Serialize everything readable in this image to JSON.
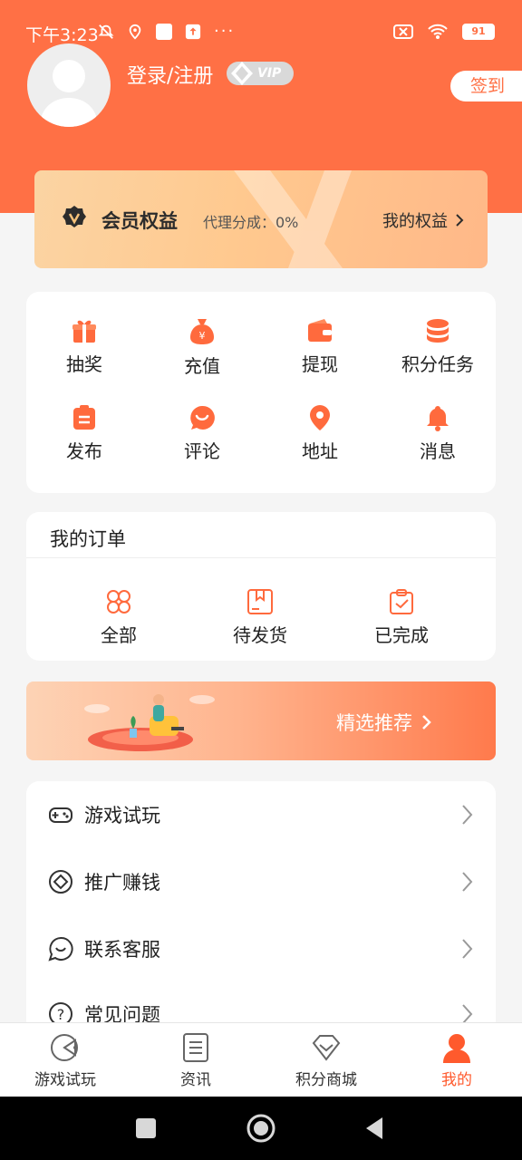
{
  "status_bar": {
    "time": "下午3:23",
    "battery": "91"
  },
  "header": {
    "login_label": "登录/注册",
    "vip_label": "VIP",
    "signin_label": "签到"
  },
  "member_card": {
    "title": "会员权益",
    "subtitle": "代理分成：0%",
    "link_label": "我的权益"
  },
  "grid": {
    "items": [
      {
        "label": "抽奖",
        "icon": "gift-icon"
      },
      {
        "label": "充值",
        "icon": "money-bag-icon"
      },
      {
        "label": "提现",
        "icon": "wallet-icon"
      },
      {
        "label": "积分任务",
        "icon": "coins-icon"
      },
      {
        "label": "发布",
        "icon": "clipboard-icon"
      },
      {
        "label": "评论",
        "icon": "comment-icon"
      },
      {
        "label": "地址",
        "icon": "location-pin-icon"
      },
      {
        "label": "消息",
        "icon": "bell-icon"
      }
    ]
  },
  "orders": {
    "title": "我的订单",
    "items": [
      {
        "label": "全部",
        "icon": "grid-clover-icon"
      },
      {
        "label": "待发货",
        "icon": "package-icon"
      },
      {
        "label": "已完成",
        "icon": "clipboard-check-icon"
      }
    ]
  },
  "banner": {
    "label": "精选推荐"
  },
  "menu": {
    "items": [
      {
        "label": "游戏试玩",
        "icon": "gamepad-icon"
      },
      {
        "label": "推广赚钱",
        "icon": "promote-icon"
      },
      {
        "label": "联系客服",
        "icon": "chat-icon"
      },
      {
        "label": "常见问题",
        "icon": "question-icon"
      }
    ]
  },
  "tabbar": {
    "items": [
      {
        "label": "游戏试玩",
        "icon": "game-tab-icon",
        "active": false
      },
      {
        "label": "资讯",
        "icon": "news-tab-icon",
        "active": false
      },
      {
        "label": "积分商城",
        "icon": "diamond-tab-icon",
        "active": false
      },
      {
        "label": "我的",
        "icon": "user-tab-icon",
        "active": true
      }
    ]
  },
  "colors": {
    "accent": "#ff7045",
    "active_tab": "#ff5a2d",
    "member_card": "#ffc98f"
  }
}
